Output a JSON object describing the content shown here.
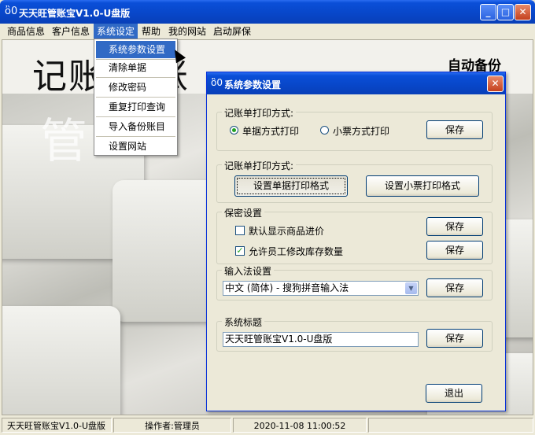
{
  "main": {
    "title": "天天旺管账宝V1.0-U盘版",
    "title_icon": "money-bag-icon",
    "big_title": "记账   管账",
    "auto_backup": "自动备份",
    "watermark": "管"
  },
  "menubar": {
    "items": [
      {
        "label": "商品信息"
      },
      {
        "label": "客户信息"
      },
      {
        "label": "系统设定"
      },
      {
        "label": "帮助"
      },
      {
        "label": "我的网站"
      },
      {
        "label": "启动屏保"
      }
    ]
  },
  "dropdown": {
    "items": [
      {
        "label": "系统参数设置"
      },
      {
        "label": "清除单据"
      },
      {
        "label": "修改密码"
      },
      {
        "label": "重复打印查询"
      },
      {
        "label": "导入备份账目"
      },
      {
        "label": "设置网站"
      }
    ]
  },
  "dialog": {
    "title": "系统参数设置",
    "group1": {
      "label": "记账单打印方式:",
      "radio1": "单据方式打印",
      "radio2": "小票方式打印",
      "save": "保存"
    },
    "group2": {
      "label": "记账单打印方式:",
      "btn1": "设置单据打印格式",
      "btn2": "设置小票打印格式"
    },
    "group3": {
      "label": "保密设置",
      "check1": "默认显示商品进价",
      "check2": "允许员工修改库存数量",
      "save1": "保存",
      "save2": "保存"
    },
    "group4": {
      "label": "输入法设置",
      "ime_value": "中文 (简体) - 搜狗拼音输入法",
      "save": "保存"
    },
    "group5": {
      "label": "系统标题",
      "title_value": "天天旺管账宝V1.0-U盘版",
      "save": "保存"
    },
    "exit": "退出"
  },
  "statusbar": {
    "app": "天天旺管账宝V1.0-U盘版",
    "operator": "操作者:管理员",
    "datetime": "2020-11-08  11:00:52"
  }
}
